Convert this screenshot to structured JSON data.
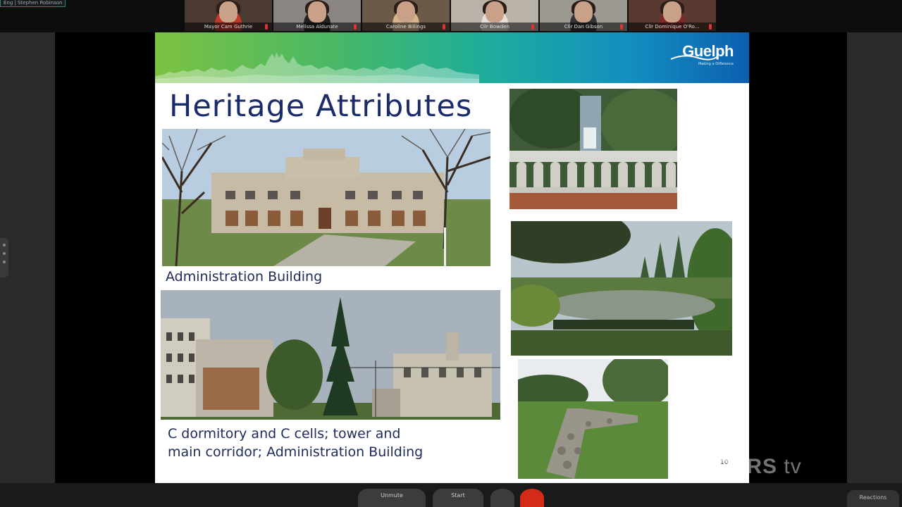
{
  "meeting": {
    "speaker_label": "Eng | Stephen Robinson"
  },
  "participants": [
    {
      "name": "Mayor Cam Guthrie",
      "shirt": "#c0392b",
      "bg": "#4a3a32"
    },
    {
      "name": "Melissa Aldunate",
      "shirt": "#222222",
      "bg": "#8a8580"
    },
    {
      "name": "Caroline Billings",
      "shirt": "#d6b48a",
      "bg": "#6b5a48"
    },
    {
      "name": "Cllr Bowden",
      "shirt": "#e8e0d8",
      "bg": "#b8b2a8"
    },
    {
      "name": "Cllr Dan Gibson",
      "shirt": "#333333",
      "bg": "#9a9890"
    },
    {
      "name": "Cllr Dominique O'Ro...",
      "shirt": "#7a2a2a",
      "bg": "#5a3a30"
    }
  ],
  "slide": {
    "logo_text": "Guelph",
    "logo_tagline": "Making a Difference",
    "title": "Heritage Attributes",
    "caption_1": "Administration Building",
    "caption_2_line1": "C dormitory and C cells; tower and",
    "caption_2_line2": "main corridor; Administration Building",
    "page_number": "10",
    "colors": {
      "title": "#1b2a6b",
      "banner_start": "#7cc242",
      "banner_end": "#0d5fb0"
    }
  },
  "watermark": {
    "brand": "ROGERS",
    "suffix": "tv"
  },
  "toolbar": {
    "mute_label": "Unmute",
    "video_label": "Start",
    "chat_label": "Reactions"
  }
}
